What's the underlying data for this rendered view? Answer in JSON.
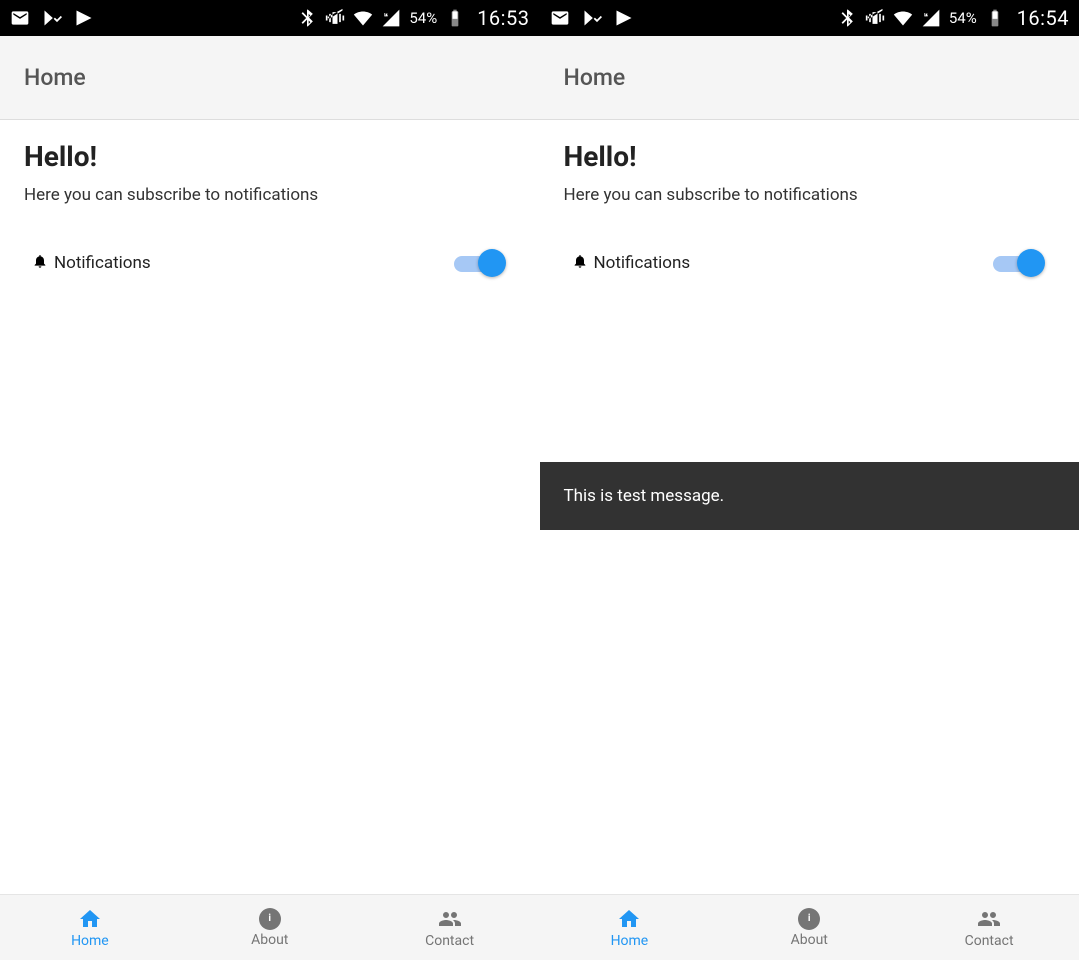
{
  "screens": [
    {
      "status": {
        "battery": "54%",
        "clock": "16:53"
      },
      "appbar": {
        "title": "Home"
      },
      "content": {
        "heading": "Hello!",
        "subtext": "Here you can subscribe to notifications",
        "notif_label": "Notifications",
        "toggle_on": true
      },
      "snackbar": null,
      "nav": [
        {
          "label": "Home",
          "active": true,
          "icon": "home"
        },
        {
          "label": "About",
          "active": false,
          "icon": "info"
        },
        {
          "label": "Contact",
          "active": false,
          "icon": "people"
        }
      ]
    },
    {
      "status": {
        "battery": "54%",
        "clock": "16:54"
      },
      "appbar": {
        "title": "Home"
      },
      "content": {
        "heading": "Hello!",
        "subtext": "Here you can subscribe to notifications",
        "notif_label": "Notifications",
        "toggle_on": true
      },
      "snackbar": {
        "message": "This is test message."
      },
      "nav": [
        {
          "label": "Home",
          "active": true,
          "icon": "home"
        },
        {
          "label": "About",
          "active": false,
          "icon": "info"
        },
        {
          "label": "Contact",
          "active": false,
          "icon": "people"
        }
      ]
    }
  ]
}
